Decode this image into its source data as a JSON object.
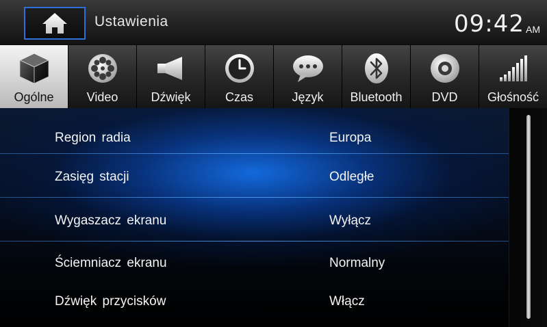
{
  "header": {
    "title": "Ustawienia",
    "home_icon": "home-icon",
    "clock_time": "09:42",
    "clock_ampm": "AM",
    "home_border_color": "#2f6fd8"
  },
  "tabs": [
    {
      "label": "Ogólne",
      "icon": "cube-icon",
      "active": true
    },
    {
      "label": "Video",
      "icon": "film-reel-icon",
      "active": false
    },
    {
      "label": "Dźwięk",
      "icon": "speaker-icon",
      "active": false
    },
    {
      "label": "Czas",
      "icon": "clock-icon",
      "active": false
    },
    {
      "label": "Język",
      "icon": "speech-bubble-icon",
      "active": false
    },
    {
      "label": "Bluetooth",
      "icon": "bluetooth-icon",
      "active": false
    },
    {
      "label": "DVD",
      "icon": "disc-icon",
      "active": false
    },
    {
      "label": "Głośność",
      "icon": "volume-bars-icon",
      "active": false
    }
  ],
  "settings": [
    {
      "label": "Region radia",
      "value": "Europa"
    },
    {
      "label": "Zasięg stacji",
      "value": "Odległe"
    },
    {
      "label": "Wygaszacz ekranu",
      "value": "Wyłącz"
    },
    {
      "label": "Ściemniacz ekranu",
      "value": "Normalny"
    },
    {
      "label": "Dźwięk przycisków",
      "value": "Włącz"
    }
  ],
  "colors": {
    "accent_blue": "#1e6ee6",
    "active_tab": "#d4d4d4"
  }
}
